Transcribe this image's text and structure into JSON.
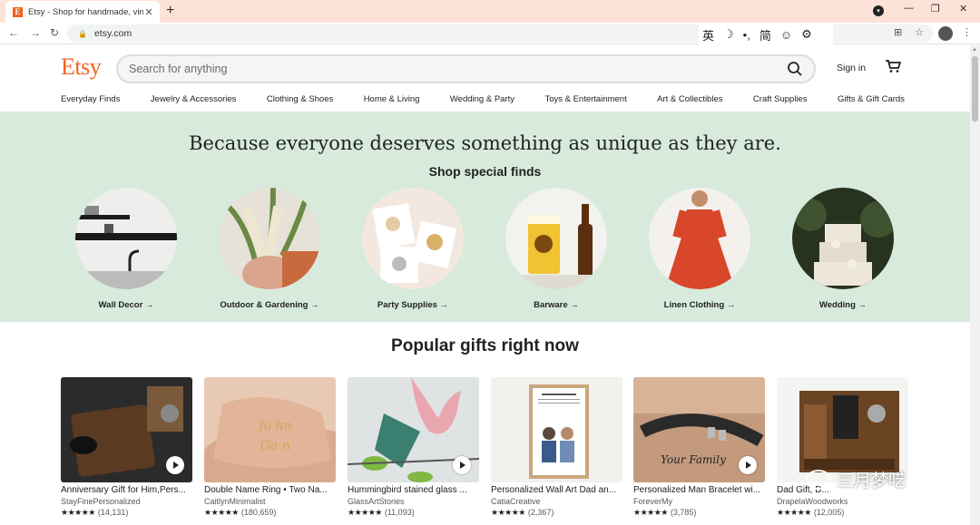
{
  "browser": {
    "tab_title": "Etsy - Shop for handmade, vin",
    "tab_favicon": "E",
    "url": "etsy.com",
    "ime_toolbar": [
      "英",
      "☽",
      "•,",
      "简",
      "☺",
      "⚙"
    ]
  },
  "header": {
    "logo": "Etsy",
    "search_placeholder": "Search for anything",
    "signin_label": "Sign in",
    "accent_color": "#f1641e"
  },
  "categories": [
    "Everyday Finds",
    "Jewelry & Accessories",
    "Clothing & Shoes",
    "Home & Living",
    "Wedding & Party",
    "Toys & Entertainment",
    "Art & Collectibles",
    "Craft Supplies",
    "Gifts & Gift Cards"
  ],
  "hero": {
    "title": "Because everyone deserves something as unique as they are.",
    "subtitle": "Shop special finds",
    "items": [
      {
        "label": "Wall Decor"
      },
      {
        "label": "Outdoor & Gardening"
      },
      {
        "label": "Party Supplies"
      },
      {
        "label": "Barware"
      },
      {
        "label": "Linen Clothing"
      },
      {
        "label": "Wedding"
      }
    ]
  },
  "popular": {
    "title": "Popular gifts right now",
    "items": [
      {
        "name": "Anniversary Gift for Him,Pers...",
        "shop": "StayFinePersonalized",
        "count": "(14,131)"
      },
      {
        "name": "Double Name Ring • Two Na...",
        "shop": "CaitlynMinimalist",
        "count": "(180,659)"
      },
      {
        "name": "Hummingbird stained glass ...",
        "shop": "GlassArtStories",
        "count": "(11,093)"
      },
      {
        "name": "Personalized Wall Art Dad an...",
        "shop": "CatiaCreative",
        "count": "(2,367)"
      },
      {
        "name": "Personalized Man Bracelet wi...",
        "shop": "ForeverMy",
        "count": "(3,785)"
      },
      {
        "name": "Dad Gift, D...",
        "shop": "DrapelaWoodworks",
        "count": "(12,005)"
      }
    ],
    "stars": "★★★★★"
  },
  "watermark": "三月梦呓"
}
